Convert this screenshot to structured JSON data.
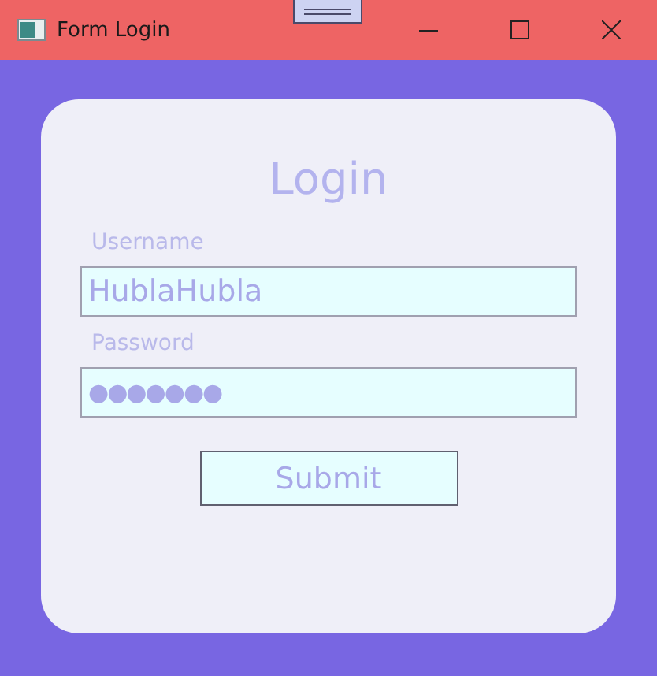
{
  "window": {
    "title": "Form Login"
  },
  "form": {
    "heading": "Login",
    "fields": [
      {
        "label": "Username",
        "value": "HublaHubla",
        "kind": "text"
      },
      {
        "label": "Password",
        "value": "●●●●●●●",
        "kind": "password"
      }
    ],
    "submit": "Submit"
  }
}
